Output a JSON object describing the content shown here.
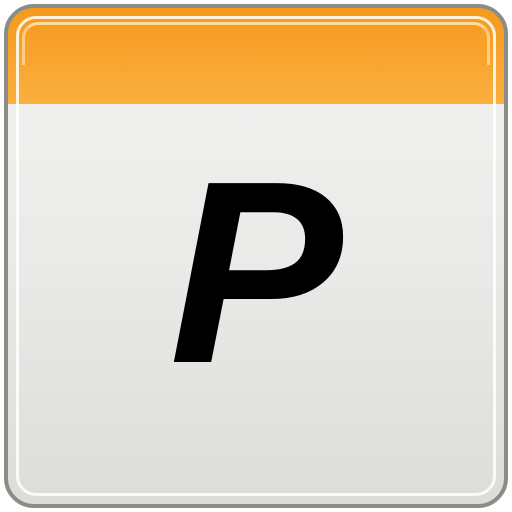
{
  "app_icon": {
    "letter": "P",
    "header_color": "#f9a532",
    "header_border_color": "#d0650b",
    "body_color": "#e9e9e7",
    "border_color": "#8a8c87"
  }
}
